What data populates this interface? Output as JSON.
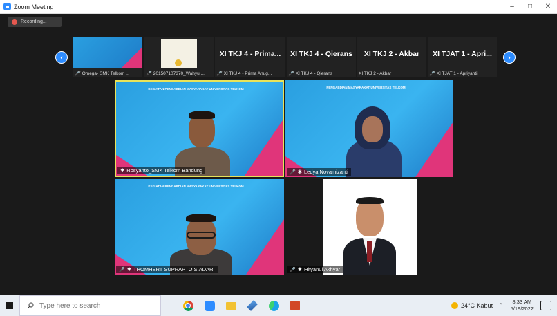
{
  "window": {
    "title": "Zoom Meeting"
  },
  "recording": {
    "label": "Recording..."
  },
  "strip": {
    "thumbs": [
      {
        "type": "screen",
        "caption": "Omega- SMK Telkom ..."
      },
      {
        "type": "doc",
        "caption": "201507107370_Wahyu ..."
      },
      {
        "type": "name",
        "big": "XI TKJ 4 - Prima...",
        "caption": "XI TKJ 4 - Prima Anug..."
      },
      {
        "type": "name",
        "big": "XI TKJ 4 - Qierans",
        "caption": "XI TKJ 4 - Qierans"
      },
      {
        "type": "name",
        "big": "XI TKJ 2 - Akbar",
        "caption": "XI TKJ 2 - Akbar"
      },
      {
        "type": "name",
        "big": "XI TJAT 1 - Apri...",
        "caption": "XI TJAT 1 - Apriyanti"
      }
    ]
  },
  "tiles": [
    {
      "name": "Rosyanto_SMK Telkom Bandung",
      "banner": "KEGIATAN PENGABDIAN MASYARAKAT UNIVERSITAS TELKOM"
    },
    {
      "name": "Ledya Novamizanti",
      "banner": "PENGABDIAN MASYARAKAT UNIVERSITAS TELKOM"
    },
    {
      "name": "THOMHERT SUPRAPTO SIADARI",
      "banner": "KEGIATAN PENGABDIAN MASYARAKAT UNIVERSITAS TELKOM"
    },
    {
      "name": "Hityanul Akhyar",
      "banner": ""
    }
  ],
  "taskbar": {
    "search_placeholder": "Type here to search",
    "weather": "24°C  Kabut",
    "time": "8:33 AM",
    "date": "5/19/2022"
  },
  "colors": {
    "accent": "#2d8cff",
    "active_speaker": "#e8e35a",
    "mute": "#e5584f"
  }
}
